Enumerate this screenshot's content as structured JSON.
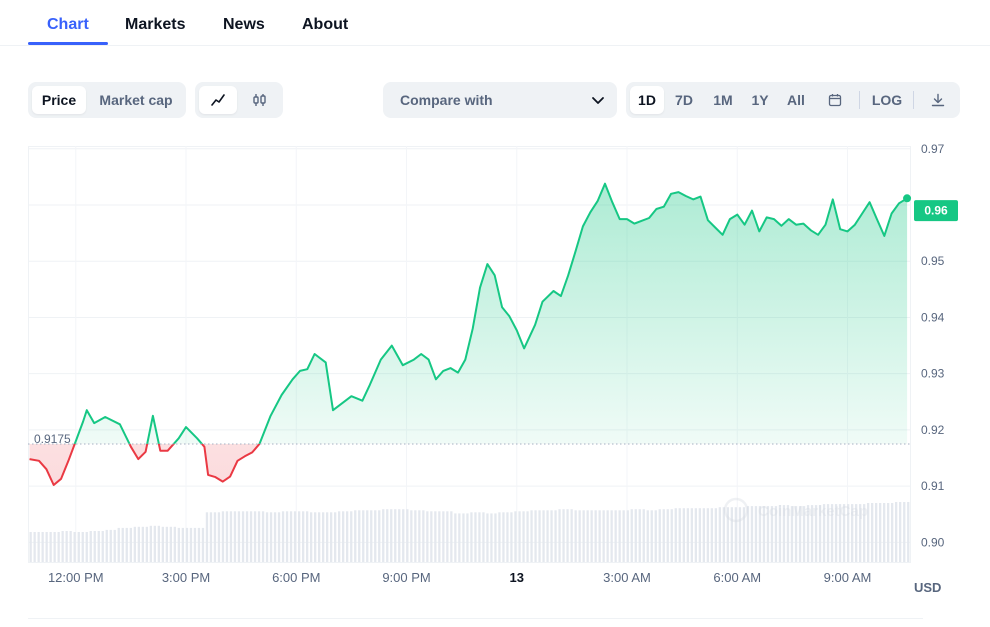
{
  "tabs": [
    {
      "label": "Chart",
      "active": true
    },
    {
      "label": "Markets",
      "active": false
    },
    {
      "label": "News",
      "active": false
    },
    {
      "label": "About",
      "active": false
    }
  ],
  "toolbar": {
    "metric_toggle": [
      "Price",
      "Market cap"
    ],
    "metric_active": "Price",
    "chart_type_icons": [
      "line-chart-icon",
      "candlestick-icon"
    ],
    "compare": {
      "label": "Compare with"
    },
    "ranges": [
      "1D",
      "7D",
      "1M",
      "1Y",
      "All"
    ],
    "range_active": "1D",
    "log_label": "LOG",
    "icons": [
      "calendar-icon",
      "download-icon"
    ]
  },
  "chart_data": {
    "type": "area",
    "title": "",
    "xlabel": "",
    "ylabel": "",
    "unit_label": "USD",
    "ylim": [
      0.8965,
      0.9705
    ],
    "y_ticks": [
      "0.97",
      "0.96",
      "0.95",
      "0.94",
      "0.93",
      "0.92",
      "0.91",
      "0.90"
    ],
    "y_tick_values": [
      0.97,
      0.96,
      0.95,
      0.94,
      0.93,
      0.92,
      0.91,
      0.9
    ],
    "x_ticks": [
      {
        "label": "12:00 PM",
        "value": 12,
        "bold": false
      },
      {
        "label": "3:00 PM",
        "value": 15,
        "bold": false
      },
      {
        "label": "6:00 PM",
        "value": 18,
        "bold": false
      },
      {
        "label": "9:00 PM",
        "value": 21,
        "bold": false
      },
      {
        "label": "13",
        "value": 24,
        "bold": true
      },
      {
        "label": "3:00 AM",
        "value": 27,
        "bold": false
      },
      {
        "label": "6:00 AM",
        "value": 30,
        "bold": false
      },
      {
        "label": "9:00 AM",
        "value": 33,
        "bold": false
      }
    ],
    "x_range": [
      10.7,
      34.7
    ],
    "reference_price": 0.9175,
    "reference_label": "0.9175",
    "current_price": 0.959,
    "current_label": "0.96",
    "up_color": "#16c784",
    "down_color": "#ea3943",
    "watermark": "CoinMarketCap",
    "x": [
      10.74,
      11.0,
      11.2,
      11.4,
      11.6,
      11.8,
      12.0,
      12.2,
      12.3,
      12.5,
      12.8,
      13.2,
      13.5,
      13.7,
      13.9,
      14.1,
      14.3,
      14.5,
      14.8,
      15.0,
      15.3,
      15.5,
      15.6,
      15.8,
      16.0,
      16.2,
      16.4,
      16.6,
      16.8,
      17.0,
      17.3,
      17.6,
      17.9,
      18.1,
      18.3,
      18.5,
      18.8,
      19.0,
      19.2,
      19.5,
      19.8,
      20.0,
      20.3,
      20.6,
      20.9,
      21.2,
      21.4,
      21.6,
      21.8,
      22.0,
      22.2,
      22.4,
      22.6,
      22.8,
      23.0,
      23.2,
      23.4,
      23.6,
      23.8,
      24.0,
      24.2,
      24.5,
      24.7,
      25.0,
      25.2,
      25.4,
      25.6,
      25.8,
      26.0,
      26.2,
      26.4,
      26.6,
      26.8,
      27.0,
      27.2,
      27.4,
      27.6,
      27.8,
      28.0,
      28.2,
      28.4,
      28.6,
      28.8,
      29.0,
      29.2,
      29.4,
      29.6,
      29.8,
      30.0,
      30.2,
      30.4,
      30.6,
      30.8,
      31.0,
      31.2,
      31.4,
      31.6,
      31.8,
      32.0,
      32.2,
      32.4,
      32.6,
      32.8,
      33.0,
      33.2,
      33.4,
      33.6,
      33.8,
      34.0,
      34.2,
      34.4,
      34.62
    ],
    "values": [
      0.9148,
      0.9145,
      0.913,
      0.9102,
      0.9113,
      0.9145,
      0.918,
      0.9215,
      0.9235,
      0.9212,
      0.9223,
      0.921,
      0.917,
      0.9148,
      0.9161,
      0.9225,
      0.9163,
      0.9163,
      0.9185,
      0.9205,
      0.9185,
      0.917,
      0.912,
      0.9116,
      0.9108,
      0.9117,
      0.9145,
      0.9153,
      0.916,
      0.9175,
      0.9225,
      0.9262,
      0.929,
      0.9305,
      0.9308,
      0.9335,
      0.932,
      0.9235,
      0.9245,
      0.926,
      0.9252,
      0.928,
      0.9325,
      0.935,
      0.9315,
      0.9325,
      0.9335,
      0.9325,
      0.929,
      0.9305,
      0.931,
      0.9302,
      0.9325,
      0.938,
      0.9453,
      0.9495,
      0.9475,
      0.9418,
      0.9402,
      0.9377,
      0.9345,
      0.9387,
      0.9428,
      0.9447,
      0.9438,
      0.9475,
      0.9518,
      0.9562,
      0.9587,
      0.9607,
      0.9638,
      0.9605,
      0.9575,
      0.9575,
      0.9567,
      0.9572,
      0.9577,
      0.9593,
      0.9597,
      0.962,
      0.9623,
      0.9616,
      0.961,
      0.9615,
      0.9573,
      0.956,
      0.9547,
      0.9575,
      0.9583,
      0.9565,
      0.959,
      0.9553,
      0.9578,
      0.9575,
      0.9563,
      0.9575,
      0.9565,
      0.9567,
      0.9555,
      0.9547,
      0.9565,
      0.961,
      0.9557,
      0.9553,
      0.9565,
      0.9585,
      0.9605,
      0.9575,
      0.9545,
      0.9585,
      0.9603,
      0.9612,
      0.964,
      0.9595,
      0.959
    ],
    "volume_series": {
      "x_range": [
        10.74,
        34.62
      ],
      "values": [
        2.9,
        2.9,
        3.0,
        2.9,
        3.0,
        3.1,
        3.3,
        3.4,
        3.5,
        3.4,
        3.3,
        3.3,
        4.8,
        4.9,
        4.9,
        4.9,
        4.8,
        4.9,
        4.9,
        4.8,
        4.8,
        4.9,
        5.0,
        5.0,
        5.1,
        5.1,
        5.0,
        4.9,
        4.9,
        4.7,
        4.8,
        4.7,
        4.8,
        4.9,
        5.0,
        5.0,
        5.1,
        5.0,
        5.0,
        5.0,
        5.0,
        5.1,
        5.0,
        5.1,
        5.2,
        5.2,
        5.2,
        5.3,
        5.3,
        5.4,
        5.4,
        5.5,
        5.4,
        5.5,
        5.6,
        5.6,
        5.6,
        5.7,
        5.7,
        5.8
      ]
    }
  }
}
